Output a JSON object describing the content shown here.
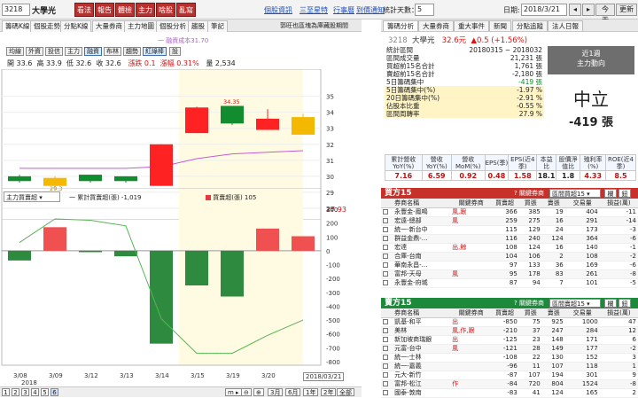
{
  "topbar": {
    "stock_code": "3218",
    "stock_name": "大學光",
    "red_buttons": [
      "看法",
      "報告",
      "體檢",
      "主力",
      "啥股",
      "亂寫"
    ],
    "links": [
      "個股資訊",
      "三至星特",
      "行事曆",
      "到價通知"
    ],
    "range_label": "統計天數：",
    "range_value": "5",
    "date_label": "日期:",
    "date_value": "2018/3/21",
    "today_btn": "今天",
    "refresh_btn": "更新"
  },
  "left_tabs": [
    "籌碼K線",
    "個股走勢",
    "分點K線",
    "大量券商",
    "主力地圖",
    "個股分析",
    "趨股",
    "筆記"
  ],
  "chart_note": "郭旺也區塊為庫藏股期間",
  "ma_legend": "一 融資成本31.70",
  "chart_buttons": [
    "均線",
    "外資",
    "投信",
    "主力",
    "融資",
    "布林",
    "趨勢",
    "紅綠棒",
    "設"
  ],
  "quote_line": {
    "open": "開 33.6",
    "high": "高 33.9",
    "low": "低 32.6",
    "close": "收 32.6",
    "change": "漲跌 0.1",
    "pct": "漲幅 0.31%",
    "volume": "量 2,534"
  },
  "price_axis": [
    "35",
    "34",
    "33",
    "32",
    "31",
    "30",
    "29",
    "28"
  ],
  "last_price_tag": "27.93",
  "price_labels": [
    "29.3",
    "34.35"
  ],
  "lower_panel": {
    "select": "主力買賣超",
    "legend1": "一 累計買賣超(張) -1,019",
    "legend2": "買賣超(張) 105",
    "axis": [
      "300",
      "200",
      "100",
      "0",
      "-100",
      "-200",
      "-300",
      "-400",
      "-500",
      "-600",
      "-700",
      "-800"
    ]
  },
  "x_dates": [
    "3/08",
    "3/09",
    "3/12",
    "3/13",
    "3/14",
    "3/15",
    "3/19",
    "3/20"
  ],
  "x_year": "2018",
  "x_last": "2018/03/21",
  "bottombar": {
    "pages": [
      "1",
      "2",
      "3",
      "4",
      "5",
      "6"
    ],
    "zoom": [
      "3月",
      "6月",
      "1年",
      "2年",
      "全部",
      "設定"
    ]
  },
  "right_tabs": [
    "籌碼分析",
    "大量券商",
    "重大事件",
    "新聞",
    "分點追蹤",
    "法人日報"
  ],
  "stock_head": {
    "code": "3218",
    "name": "大學光",
    "price": "32.6元",
    "change": "▲0.5 (+1.56%)"
  },
  "stats": [
    {
      "label": "統計區間",
      "value": "20180315 ~ 2018032"
    },
    {
      "label": "區間成交量",
      "value": "21,231 張"
    },
    {
      "label": "買超前15名合計",
      "value": "1,761 張"
    },
    {
      "label": "賣超前15名合計",
      "value": "-2,180 張"
    },
    {
      "label": "5日籌碼集中",
      "value": "-419 張"
    },
    {
      "label": "5日籌碼集中(%)",
      "value": "-1.97 %"
    },
    {
      "label": "20日籌碼集中(%)",
      "value": "-2.91 %"
    },
    {
      "label": "佔股本比重",
      "value": "-0.55 %"
    },
    {
      "label": "區間周轉率",
      "value": "27.9 %"
    }
  ],
  "trend_box": {
    "title1": "近1週",
    "title2": "主力動向",
    "verdict": "中立",
    "amount": "-419 張"
  },
  "metrics": {
    "headers": [
      "累計營收YoY(%)",
      "營收YoY(%)",
      "營收MoM(%)",
      "EPS(季)",
      "EPS(近4季)",
      "本益比",
      "股價淨值比",
      "殖利率(%)",
      "ROE(近4季)"
    ],
    "values": [
      "7.16",
      "6.59",
      "0.92",
      "0.48",
      "1.58",
      "18.1",
      "1.8",
      "4.33",
      "8.5"
    ]
  },
  "buy_table": {
    "title": "買方15",
    "hint": "? 關鍵券商",
    "select": "區間買超15",
    "btns": [
      "欄",
      "鈕"
    ],
    "headers": [
      "券商名稱",
      "關鍵券商",
      "買賣超",
      "買張",
      "賣張",
      "交易量",
      "損益(萬)"
    ],
    "rows": [
      [
        "永豐金-鳳鳴",
        "風,跟",
        "366",
        "385",
        "19",
        "404",
        "-11"
      ],
      [
        "宏遠-總部",
        "風",
        "259",
        "275",
        "16",
        "291",
        "-14"
      ],
      [
        "統一-新台中",
        "",
        "115",
        "129",
        "24",
        "173",
        "-3"
      ],
      [
        "群益金鼎-...",
        "",
        "116",
        "240",
        "124",
        "364",
        "-6"
      ],
      [
        "宏達",
        "出,鯨",
        "108",
        "124",
        "16",
        "140",
        "-1"
      ],
      [
        "合庫-台南",
        "",
        "104",
        "106",
        "2",
        "108",
        "-2"
      ],
      [
        "華南永昌-...",
        "",
        "97",
        "133",
        "36",
        "169",
        "-6"
      ],
      [
        "富邦-天母",
        "風",
        "95",
        "178",
        "83",
        "261",
        "-8"
      ],
      [
        "永豐金-府城",
        "",
        "87",
        "94",
        "7",
        "101",
        "-5"
      ]
    ]
  },
  "sell_table": {
    "title": "賣方15",
    "hint": "? 關鍵券商",
    "select": "區間賣超15",
    "btns": [
      "欄",
      "鈕"
    ],
    "headers": [
      "券商名稱",
      "關鍵券商",
      "買賣超",
      "買張",
      "賣張",
      "交易量",
      "損益(萬)"
    ],
    "rows": [
      [
        "凱基-和平",
        "出",
        "-850",
        "75",
        "925",
        "1000",
        "47"
      ],
      [
        "美林",
        "風,作,跟",
        "-210",
        "37",
        "247",
        "284",
        "12"
      ],
      [
        "新加坡商瑞銀",
        "出",
        "-125",
        "23",
        "148",
        "171",
        "6"
      ],
      [
        "元富-台中",
        "風",
        "-121",
        "28",
        "149",
        "177",
        "-2"
      ],
      [
        "統一-士林",
        "",
        "-108",
        "22",
        "130",
        "152",
        "3"
      ],
      [
        "統一-嘉義",
        "",
        "-96",
        "11",
        "107",
        "118",
        "1"
      ],
      [
        "元大-新竹",
        "",
        "-87",
        "107",
        "194",
        "301",
        "9"
      ],
      [
        "富邦-松江",
        "作",
        "-84",
        "720",
        "804",
        "1524",
        "-8"
      ],
      [
        "國泰-敦南",
        "",
        "-83",
        "41",
        "124",
        "165",
        "2"
      ]
    ]
  },
  "chart_data": {
    "type": "candlestick+bar+line",
    "x": [
      "3/08",
      "3/09",
      "3/12",
      "3/13",
      "3/14",
      "3/15",
      "3/19",
      "3/20",
      "3/21"
    ],
    "candles": [
      {
        "open": 30.0,
        "close": 29.7,
        "high": 30.1,
        "low": 29.6,
        "color": "green"
      },
      {
        "open": 29.9,
        "close": 29.4,
        "high": 30.0,
        "low": 29.3,
        "color": "yellow"
      },
      {
        "open": 30.1,
        "close": 29.7,
        "high": 30.1,
        "low": 29.6,
        "color": "green"
      },
      {
        "open": 30.0,
        "close": 29.7,
        "high": 30.0,
        "low": 29.6,
        "color": "green"
      },
      {
        "open": 29.4,
        "close": 32.0,
        "high": 32.0,
        "low": 29.4,
        "color": "red"
      },
      {
        "open": 32.7,
        "close": 34.3,
        "high": 34.35,
        "low": 32.7,
        "color": "red"
      },
      {
        "open": 34.4,
        "close": 33.3,
        "high": 34.4,
        "low": 33.2,
        "color": "green"
      },
      {
        "open": 32.9,
        "close": 33.6,
        "high": 34.2,
        "low": 32.9,
        "color": "red"
      },
      {
        "open": 33.7,
        "close": 32.6,
        "high": 33.9,
        "low": 32.6,
        "color": "yellow"
      }
    ],
    "ma_line": [
      30.5,
      30.5,
      30.5,
      30.5,
      30.6,
      31.1,
      31.4,
      31.5,
      31.6
    ],
    "net_buy_sell": [
      -70,
      170,
      -10,
      -40,
      -670,
      -250,
      -330,
      160,
      105
    ],
    "cumulative": [
      60,
      230,
      220,
      180,
      -490,
      -740,
      -740,
      -610,
      -500
    ],
    "price_range": [
      27.5,
      35.7
    ],
    "lower_range": [
      -800,
      300
    ]
  }
}
